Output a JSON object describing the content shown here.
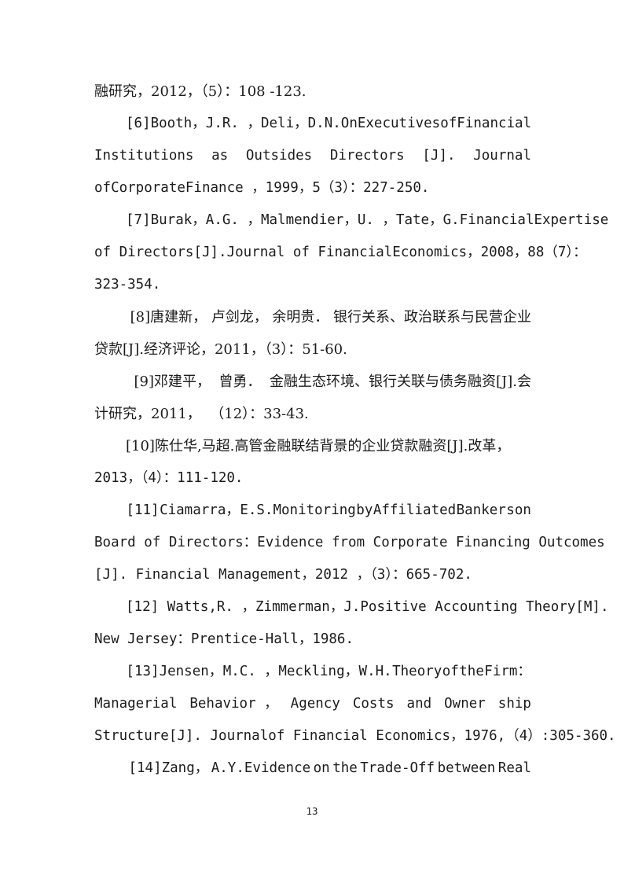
{
  "document": {
    "type": "academic-paper-references-page",
    "page_number": "13",
    "background_color": "#ffffff",
    "text_color": "#1c1c1c"
  },
  "lines": [
    {
      "id": "l1",
      "indent": false,
      "justify": false,
      "cjk": true,
      "tokens": [
        "融研究，2012，（5）：108 -123."
      ]
    },
    {
      "id": "l2",
      "indent": true,
      "justify": true,
      "cjk": false,
      "tokens": [
        "[6]",
        "Booth，",
        "J.R. ，",
        "Deli，",
        "D.N.On",
        "Executivesof",
        "Financial"
      ]
    },
    {
      "id": "l3",
      "indent": false,
      "justify": true,
      "cjk": false,
      "tokens": [
        "Institutions",
        "as",
        "Outsides",
        "Directors",
        "[J].",
        "Journal"
      ]
    },
    {
      "id": "l4",
      "indent": false,
      "justify": false,
      "cjk": false,
      "tokens": [
        "ofCorporateFinance ，1999，5（3）：227-250."
      ]
    },
    {
      "id": "l5",
      "indent": true,
      "justify": true,
      "cjk": false,
      "tokens": [
        "[7]",
        "Burak，A.G. ，Malmendier，U. ，Tate，G.",
        "Financial",
        "Expertise"
      ]
    },
    {
      "id": "l6",
      "indent": false,
      "justify": true,
      "cjk": false,
      "tokens": [
        "of Directors",
        "[J].",
        "Journal of FinancialEconomics，2008，88（7）："
      ]
    },
    {
      "id": "l7",
      "indent": false,
      "justify": false,
      "cjk": false,
      "tokens": [
        "323-354."
      ]
    },
    {
      "id": "l8",
      "indent": true,
      "justify": true,
      "cjk": true,
      "tokens": [
        "[8]唐建新，",
        "卢剑龙，",
        "余明贵．",
        "银行关系、政治联系与民营企业"
      ]
    },
    {
      "id": "l9",
      "indent": false,
      "justify": false,
      "cjk": true,
      "tokens": [
        "贷款[J].经济评论，2011，（3）：51-60."
      ]
    },
    {
      "id": "l10",
      "indent": true,
      "justify": true,
      "cjk": true,
      "tokens": [
        "[9]邓建平，",
        "曾勇．",
        "金融生态环境、银行关联与债务融资[J].会"
      ]
    },
    {
      "id": "l11",
      "indent": false,
      "justify": false,
      "cjk": true,
      "tokens": [
        "计研究，2011，  （12）：33-43."
      ]
    },
    {
      "id": "l12",
      "indent": true,
      "justify": false,
      "cjk": true,
      "tokens": [
        "[10]陈仕华,马超.高管金融联结背景的企业贷款融资[J].改革，"
      ]
    },
    {
      "id": "l13",
      "indent": false,
      "justify": false,
      "cjk": false,
      "tokens": [
        "2013，（4）：111-120."
      ]
    },
    {
      "id": "l14",
      "indent": true,
      "justify": true,
      "cjk": false,
      "tokens": [
        "[11]",
        "Ciamarra，",
        "E.S.Monitoring",
        "by",
        "Affiliated",
        "Banker",
        "son"
      ]
    },
    {
      "id": "l15",
      "indent": false,
      "justify": true,
      "cjk": false,
      "tokens": [
        "Board of Directors：",
        "Evidence from Corporate Financing Outcomes"
      ]
    },
    {
      "id": "l16",
      "indent": false,
      "justify": false,
      "cjk": false,
      "tokens": [
        "[J]. Financial Management，2012 ，（3）：665-702."
      ]
    },
    {
      "id": "l17",
      "indent": true,
      "justify": false,
      "cjk": false,
      "tokens": [
        "[12] Watts,R. ，Zimmerman，J.Positive Accounting Theory[M]."
      ]
    },
    {
      "id": "l18",
      "indent": false,
      "justify": false,
      "cjk": false,
      "tokens": [
        "New Jersey：Prentice-Hall，1986."
      ]
    },
    {
      "id": "l19",
      "indent": true,
      "justify": true,
      "cjk": false,
      "tokens": [
        "[13]Jensen，",
        "M.C. ，",
        "Meckling，",
        "W.H.",
        "Theory",
        "of",
        "the",
        "Firm："
      ]
    },
    {
      "id": "l20",
      "indent": false,
      "justify": true,
      "cjk": false,
      "tokens": [
        "Managerial",
        "Behavior ，",
        "Agency",
        "Costs",
        "and",
        "Owner",
        "ship"
      ]
    },
    {
      "id": "l21",
      "indent": false,
      "justify": false,
      "cjk": false,
      "tokens": [
        "Structure[J]. Journalof Financial Economics，1976,（4）:305-360."
      ]
    },
    {
      "id": "l22",
      "indent": true,
      "justify": true,
      "cjk": false,
      "tokens": [
        "[14]Zang，",
        "A.Y.Evidence",
        "on",
        "the",
        "Trade-Off",
        "between",
        "Real"
      ]
    }
  ],
  "footer": {
    "page_number_label": "13"
  }
}
